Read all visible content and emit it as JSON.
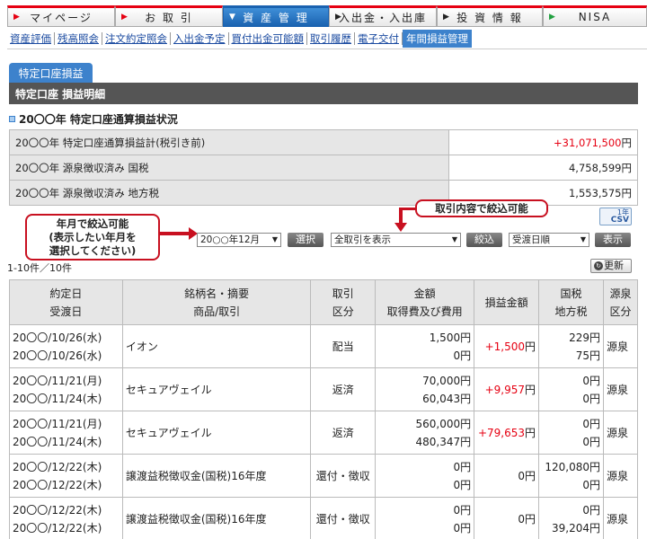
{
  "nav": {
    "tabs": [
      {
        "label": "マイページ",
        "style": "red"
      },
      {
        "label": "お 取 引",
        "style": "red"
      },
      {
        "label": "資 産 管 理",
        "style": "blue"
      },
      {
        "label": "入出金・入出庫",
        "style": "black"
      },
      {
        "label": "投 資 情 報",
        "style": "black"
      },
      {
        "label": "NISA",
        "style": "green"
      }
    ]
  },
  "subnav": {
    "items": [
      "資産評価",
      "残高照会",
      "注文約定照会",
      "入出金予定",
      "買付出金可能額",
      "取引履歴",
      "電子交付",
      "年間損益管理"
    ]
  },
  "panel": {
    "tab_label": "特定口座損益",
    "header": "特定口座 損益明細"
  },
  "summary": {
    "title": "20〇〇年 特定口座通算損益状況",
    "rows": [
      {
        "label": "20〇〇年 特定口座通算損益計(税引き前)",
        "value": "+31,071,500",
        "unit": "円",
        "red": true
      },
      {
        "label": "20〇〇年 源泉徴収済み 国税",
        "value": "4,758,599",
        "unit": "円",
        "red": false
      },
      {
        "label": "20〇〇年 源泉徴収済み 地方税",
        "value": "1,553,575",
        "unit": "円",
        "red": false
      }
    ]
  },
  "controls": {
    "csv_top": "1年",
    "csv_bottom": "CSV",
    "callout_month": "年月で絞込可能\n(表示したい年月を\n選択してください)",
    "callout_trade": "取引内容で絞込可能",
    "year_select": "20○○年12月",
    "select_button": "選択",
    "trade_select": "全取引を表示",
    "filter_button": "絞込",
    "order_select": "受渡日順",
    "show_button": "表示",
    "count": "1-10件／10件",
    "refresh": "更新"
  },
  "table": {
    "headers": [
      [
        "約定日",
        "受渡日"
      ],
      [
        "銘柄名・摘要",
        "商品/取引"
      ],
      [
        "取引",
        "区分"
      ],
      [
        "金額",
        "取得費及び費用"
      ],
      [
        "損益金額"
      ],
      [
        "国税",
        "地方税"
      ],
      [
        "源泉",
        "区分"
      ]
    ],
    "rows": [
      {
        "date1": "20〇〇/10/26(水)",
        "date2": "20〇〇/10/26(水)",
        "name": "イオン",
        "type": "配当",
        "amount1": "1,500円",
        "amount2": "0円",
        "pl": "+1,500",
        "pl_red": true,
        "tax1": "229円",
        "tax2": "75円",
        "src": "源泉"
      },
      {
        "date1": "20〇〇/11/21(月)",
        "date2": "20〇〇/11/24(木)",
        "name": "セキュアヴェイル",
        "type": "返済",
        "amount1": "70,000円",
        "amount2": "60,043円",
        "pl": "+9,957",
        "pl_red": true,
        "tax1": "0円",
        "tax2": "0円",
        "src": "源泉"
      },
      {
        "date1": "20〇〇/11/21(月)",
        "date2": "20〇〇/11/24(木)",
        "name": "セキュアヴェイル",
        "type": "返済",
        "amount1": "560,000円",
        "amount2": "480,347円",
        "pl": "+79,653",
        "pl_red": true,
        "tax1": "0円",
        "tax2": "0円",
        "src": "源泉"
      },
      {
        "date1": "20〇〇/12/22(木)",
        "date2": "20〇〇/12/22(木)",
        "name": "譲渡益税徴収金(国税)16年度",
        "type": "還付・徴収",
        "amount1": "0円",
        "amount2": "0円",
        "pl": "0",
        "pl_red": false,
        "tax1": "120,080円",
        "tax2": "0円",
        "src": "源泉"
      },
      {
        "date1": "20〇〇/12/22(木)",
        "date2": "20〇〇/12/22(木)",
        "name": "譲渡益税徴収金(国税)16年度",
        "type": "還付・徴収",
        "amount1": "0円",
        "amount2": "0円",
        "pl": "0",
        "pl_red": false,
        "tax1": "0円",
        "tax2": "39,204円",
        "src": "源泉"
      }
    ]
  }
}
